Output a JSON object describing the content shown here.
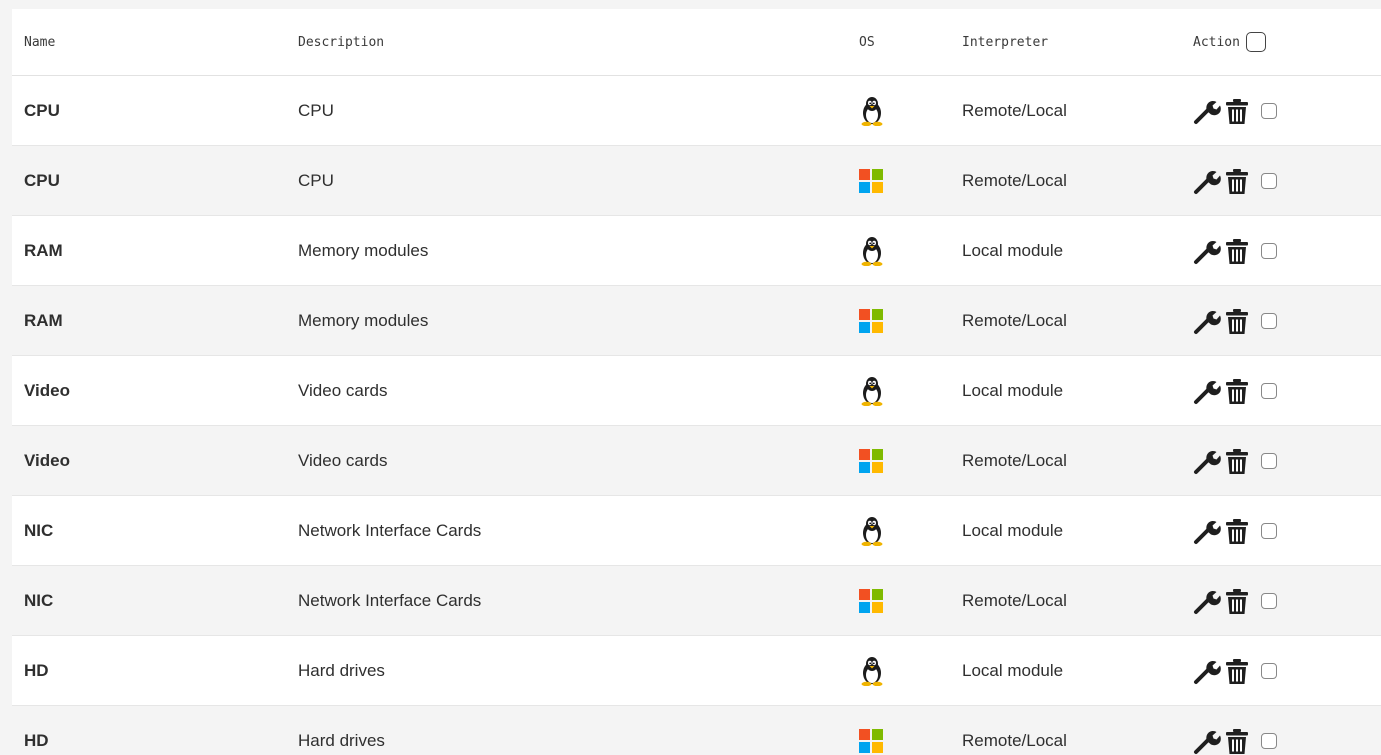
{
  "table": {
    "headers": {
      "name": "Name",
      "description": "Description",
      "os": "OS",
      "interpreter": "Interpreter",
      "action": "Action"
    },
    "rows": [
      {
        "name": "CPU",
        "description": "CPU",
        "os": "linux",
        "interpreter": "Remote/Local"
      },
      {
        "name": "CPU",
        "description": "CPU",
        "os": "windows",
        "interpreter": "Remote/Local"
      },
      {
        "name": "RAM",
        "description": "Memory modules",
        "os": "linux",
        "interpreter": "Local module"
      },
      {
        "name": "RAM",
        "description": "Memory modules",
        "os": "windows",
        "interpreter": "Remote/Local"
      },
      {
        "name": "Video",
        "description": "Video cards",
        "os": "linux",
        "interpreter": "Local module"
      },
      {
        "name": "Video",
        "description": "Video cards",
        "os": "windows",
        "interpreter": "Remote/Local"
      },
      {
        "name": "NIC",
        "description": "Network Interface Cards",
        "os": "linux",
        "interpreter": "Local module"
      },
      {
        "name": "NIC",
        "description": "Network Interface Cards",
        "os": "windows",
        "interpreter": "Remote/Local"
      },
      {
        "name": "HD",
        "description": "Hard drives",
        "os": "linux",
        "interpreter": "Local module"
      },
      {
        "name": "HD",
        "description": "Hard drives",
        "os": "windows",
        "interpreter": "Remote/Local"
      }
    ]
  },
  "icons": {
    "edit": "wrench-icon",
    "delete": "trash-icon",
    "linux": "linux-tux-icon",
    "windows": "windows-logo-icon"
  },
  "colors": {
    "win_red": "#f25022",
    "win_green": "#7fba00",
    "win_blue": "#00a4ef",
    "win_yellow": "#ffb900",
    "row_alt": "#f4f4f4"
  }
}
